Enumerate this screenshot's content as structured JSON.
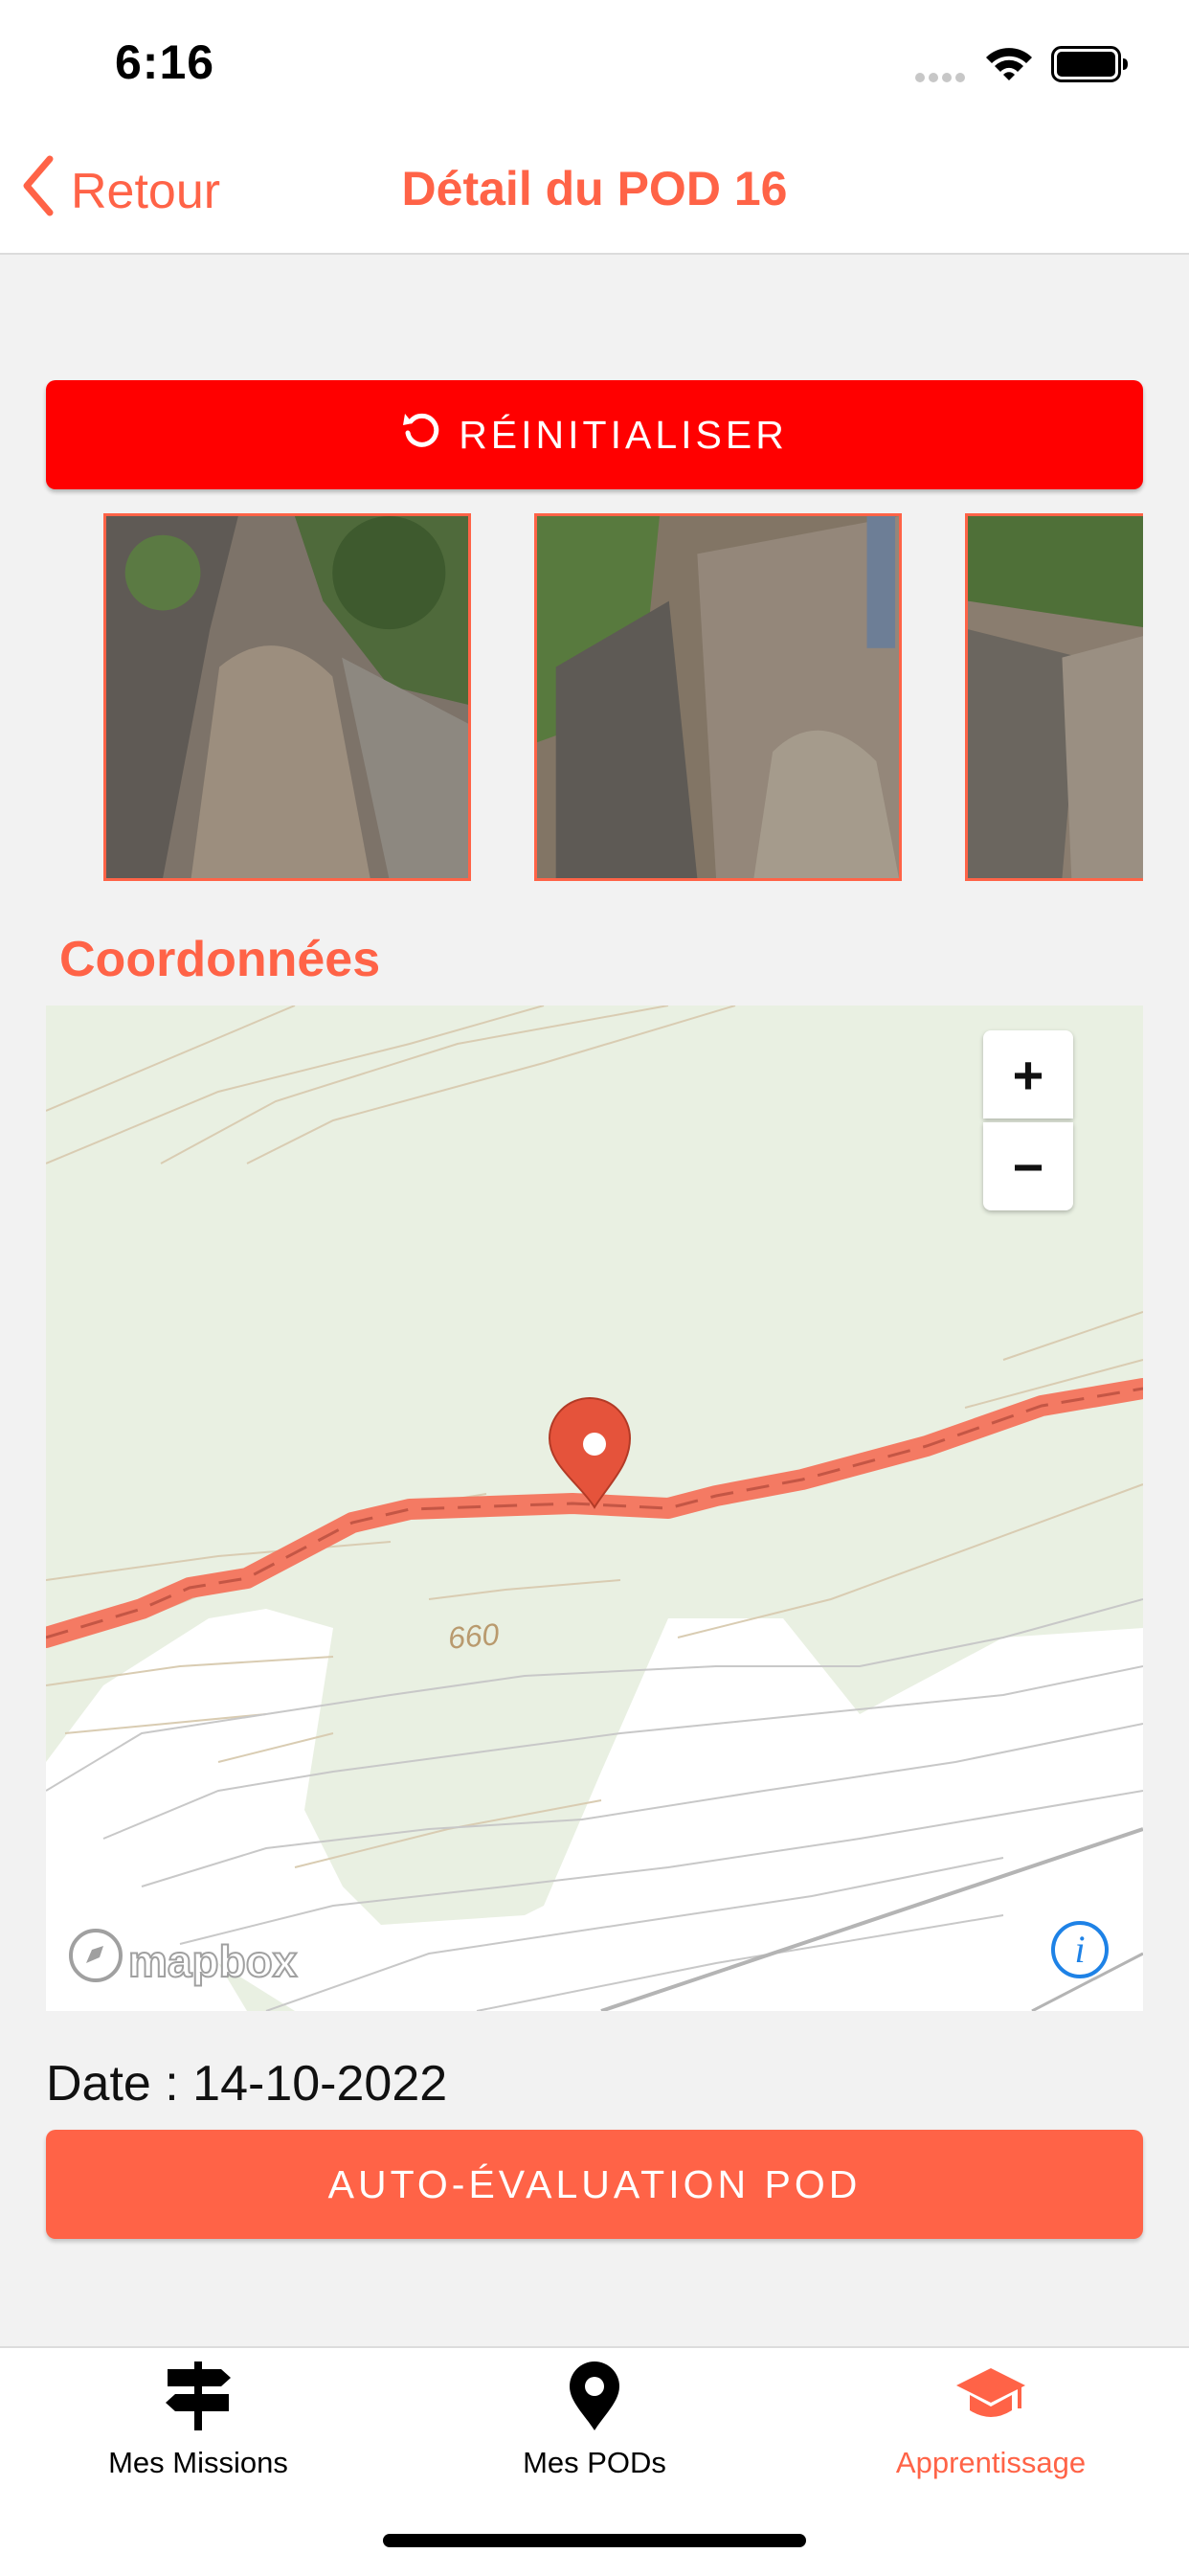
{
  "status_bar": {
    "time": "6:16"
  },
  "nav": {
    "back_label": "Retour",
    "title": "Détail du POD 16"
  },
  "actions": {
    "reset_label": "RÉINITIALISER",
    "evaluate_label": "AUTO-ÉVALUATION POD"
  },
  "photos": {
    "count_visible": 3
  },
  "coordinates": {
    "section_title": "Coordonnées",
    "map": {
      "contour_label": "660",
      "attribution": "mapbox",
      "zoom_in_label": "+",
      "zoom_out_label": "−",
      "info_label": "i"
    }
  },
  "details": {
    "date_line": "Date : 14-10-2022"
  },
  "tabs": [
    {
      "label": "Mes Missions",
      "icon": "signpost-icon",
      "active": false
    },
    {
      "label": "Mes PODs",
      "icon": "map-pin-icon",
      "active": false
    },
    {
      "label": "Apprentissage",
      "icon": "graduation-cap-icon",
      "active": true
    }
  ],
  "colors": {
    "accent": "#ff6347",
    "reset_button": "#ff0000",
    "tab_inactive": "#000000",
    "map_green": "#e9f0e2",
    "route": "#f47a63",
    "info_blue": "#1e82e6"
  }
}
